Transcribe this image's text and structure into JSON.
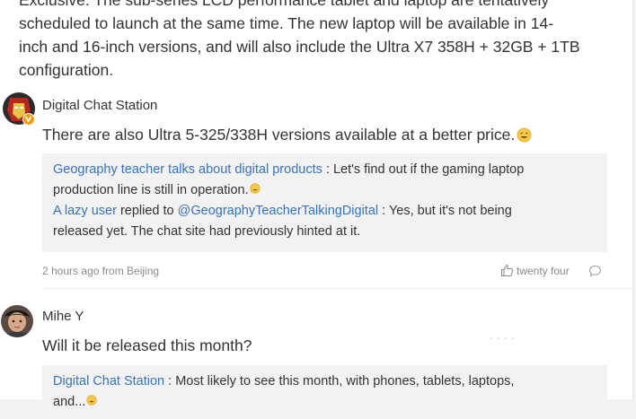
{
  "post": {
    "text_lines": [
      "Exclusive: The sub-series LCD performance tablet and laptop are tentatively",
      "scheduled to launch at the same time. The new laptop will be available in 14-",
      "inch and 16-inch versions, and will also include the Ultra X7 358H + 32GB + 1TB",
      "configuration."
    ]
  },
  "comments": [
    {
      "username": "Digital Chat Station",
      "text": "There are also Ultra 5-325/338H versions available at a better price.",
      "verified": true,
      "replies": [
        {
          "author": "Geography teacher talks about digital products",
          "sep": " : ",
          "text_line1": "Let's find out if the gaming laptop",
          "text_line2": "production line is still in operation."
        },
        {
          "author": "A lazy user",
          "mid": " replied to ",
          "target": "@GeographyTeacherTalkingDigital",
          "sep": " : ",
          "text_line1": "Yes, but it's not being",
          "text_line2": "released yet. The chat site had previously hinted at it."
        }
      ],
      "meta": "2 hours ago from Beijing",
      "likes": "twenty four"
    },
    {
      "username": "Mihe Y",
      "text": "Will it be released this month?",
      "replies": [
        {
          "author": "Digital Chat Station",
          "sep": " : ",
          "text_line1": "Most likely to see this month, with phones, tablets, laptops,",
          "text_line2": "and..."
        }
      ]
    }
  ],
  "colors": {
    "link": "#3873b8",
    "badge": "#f39c12",
    "reply_bg": "#f2f2f2"
  },
  "icons": [
    "ironman-avatar",
    "verified-badge-icon",
    "grin-emoji-icon",
    "thumbs-up-icon",
    "comment-bubble-icon",
    "person-avatar"
  ]
}
